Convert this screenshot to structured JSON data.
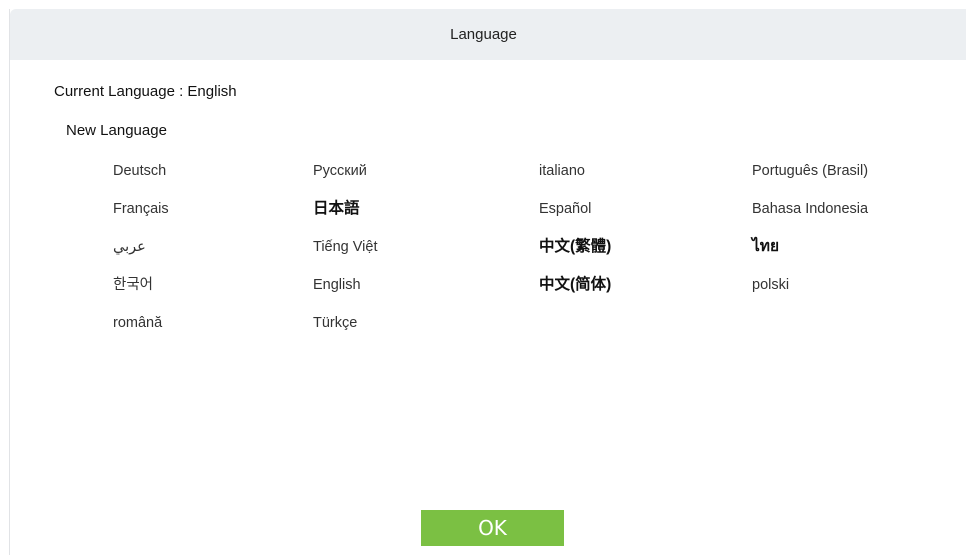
{
  "dialog": {
    "title": "Language",
    "current_language_text": "Current Language : English",
    "new_language_label": "New Language",
    "ok_label": "OK"
  },
  "languages": [
    {
      "label": "Deutsch",
      "bold": false
    },
    {
      "label": "Русский",
      "bold": false
    },
    {
      "label": "italiano",
      "bold": false
    },
    {
      "label": "Português (Brasil)",
      "bold": false
    },
    {
      "label": "Français",
      "bold": false
    },
    {
      "label": "日本語",
      "bold": true
    },
    {
      "label": "Español",
      "bold": false
    },
    {
      "label": "Bahasa Indonesia",
      "bold": false
    },
    {
      "label": "عربي",
      "bold": false
    },
    {
      "label": "Tiếng Việt",
      "bold": false
    },
    {
      "label": "中文(繁體)",
      "bold": true
    },
    {
      "label": "ไทย",
      "bold": true
    },
    {
      "label": "한국어",
      "bold": false
    },
    {
      "label": "English",
      "bold": false
    },
    {
      "label": "中文(简体)",
      "bold": true
    },
    {
      "label": "polski",
      "bold": false
    },
    {
      "label": "română",
      "bold": false
    },
    {
      "label": "Türkçe",
      "bold": false
    }
  ],
  "colors": {
    "ok_button": "#7bc043",
    "titlebar": "#eceff2"
  }
}
